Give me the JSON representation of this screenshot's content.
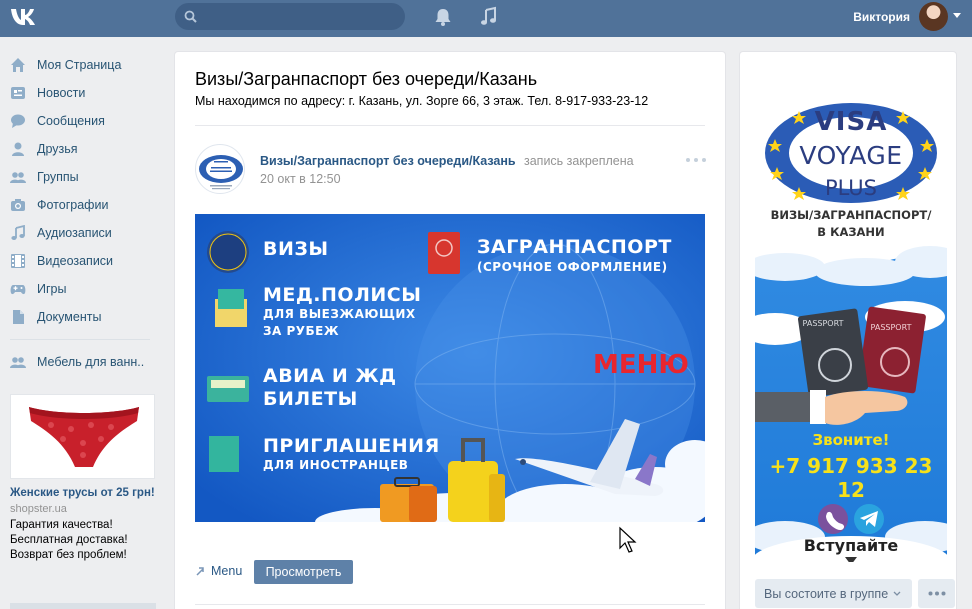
{
  "colors": {
    "header": "#507299",
    "link": "#2a5885",
    "menu_text": "#285473",
    "button": "#5e81a8",
    "banner_blue": "#1f6fd0",
    "accent_red": "#e8262e",
    "phone_yellow": "#f7e11a"
  },
  "header": {
    "logo": "vk-logo",
    "search": {
      "placeholder": ""
    },
    "notifications_icon": "bell-icon",
    "music_icon": "music-note-icon",
    "user_name": "Виктория"
  },
  "sidebar": {
    "items": [
      {
        "label": "Моя Страница",
        "icon": "home-icon"
      },
      {
        "label": "Новости",
        "icon": "news-icon"
      },
      {
        "label": "Сообщения",
        "icon": "chat-icon"
      },
      {
        "label": "Друзья",
        "icon": "person-icon"
      },
      {
        "label": "Группы",
        "icon": "group-icon"
      },
      {
        "label": "Фотографии",
        "icon": "camera-icon"
      },
      {
        "label": "Аудиозаписи",
        "icon": "music-icon"
      },
      {
        "label": "Видеозаписи",
        "icon": "film-icon"
      },
      {
        "label": "Игры",
        "icon": "gamepad-icon"
      },
      {
        "label": "Документы",
        "icon": "document-icon"
      }
    ],
    "extra_item": {
      "label": "Мебель для ванн..",
      "icon": "group-icon"
    },
    "ad": {
      "title": "Женские трусы от 25 грн!",
      "domain": "shopster.ua",
      "lines": [
        "Гарантия качества!",
        "Бесплатная доставка!",
        "Возврат без проблем!"
      ]
    }
  },
  "main": {
    "title": "Визы/Загранпаспорт без очереди/Казань",
    "status": "Мы находимся по адресу: г. Казань, ул. Зорге 66, 3 этаж. Тел. 8-917-933-23-12",
    "post": {
      "author": "Визы/Загранпаспорт без очереди/Казань",
      "pinned": "запись закреплена",
      "date": "20 окт в 12:50",
      "banner": {
        "visa": "ВИЗЫ",
        "passport": "ЗАГРАНПАСПОРТ",
        "passport_sub": "(СРОЧНОЕ ОФОРМЛЕНИЕ)",
        "med_1": "МЕД.ПОЛИСЫ",
        "med_2": "ДЛЯ ВЫЕЗЖАЮЩИХ",
        "med_3": "ЗА РУБЕЖ",
        "avia_1": "АВИА И ЖД",
        "avia_2": "БИЛЕТЫ",
        "inv_1": "ПРИГЛАШЕНИЯ",
        "inv_2": "ДЛЯ ИНОСТРАНЦЕВ",
        "menu": "МЕНЮ"
      },
      "menu_link": "Menu",
      "view_button": "Просмотреть"
    }
  },
  "right": {
    "logo_line1": "VISA",
    "logo_line2": "VOYAGE",
    "logo_line3": "PLUS",
    "caption_1": "ВИЗЫ/ЗАГРАНПАСПОРТ/",
    "caption_2": "В КАЗАНИ",
    "passport_1": "PASSPORT",
    "passport_2": "PASSPORT",
    "call": "Звоните!",
    "phone": "+7 917 933 23 12",
    "join": "Вступайте",
    "member_button": "Вы состоите в группе"
  }
}
